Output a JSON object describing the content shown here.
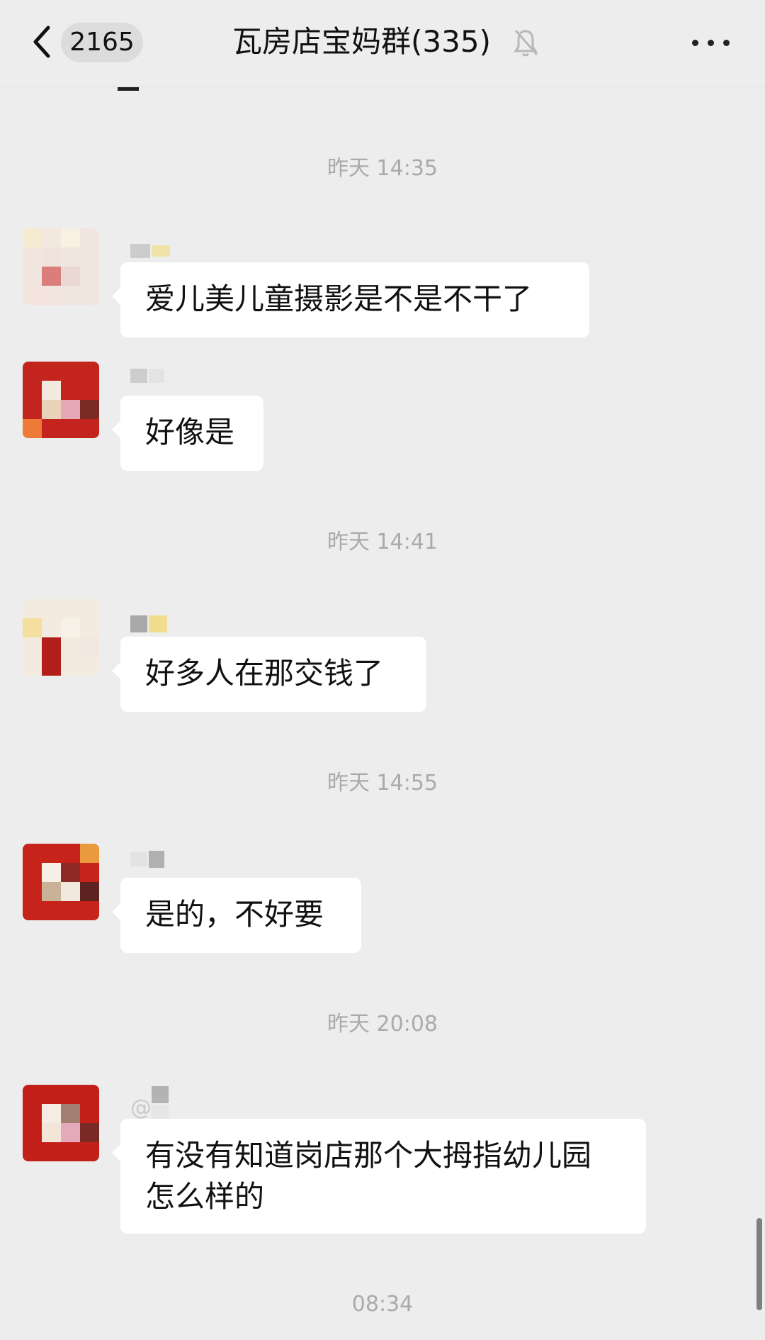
{
  "header": {
    "badge": "2165",
    "title": "瓦房店宝妈群(335)",
    "icons": [
      "back-arrow-icon",
      "mute-icon",
      "more-options-icon"
    ]
  },
  "chat": {
    "timestamps": [
      "昨天 14:35",
      "昨天 14:41",
      "昨天 14:55",
      "昨天 20:08",
      "08:34"
    ],
    "messages": [
      {
        "text": "爱儿美儿童摄影是不是不干了"
      },
      {
        "text": "好像是"
      },
      {
        "text": "好多人在那交钱了"
      },
      {
        "text": "是的，不好要"
      },
      {
        "text": "有没有知道岗店那个大拇指幼儿园\n怎么样的"
      }
    ]
  },
  "colors": {
    "background": "#ededed",
    "bubble": "#ffffff",
    "text": "#111111",
    "timestamp": "#aaaaaa"
  }
}
